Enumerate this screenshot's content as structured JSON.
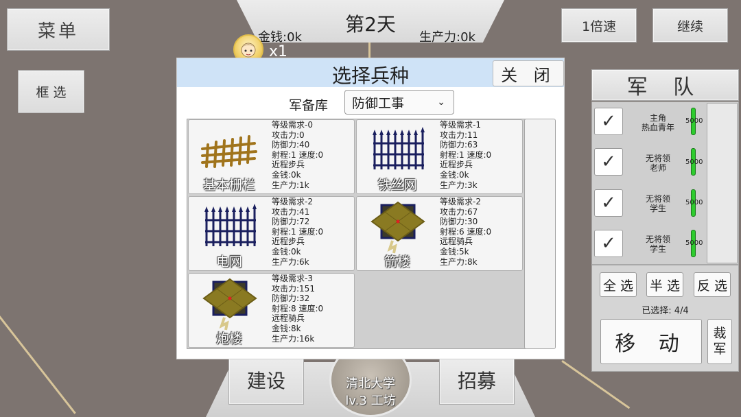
{
  "top": {
    "menu": "菜单",
    "box_select": "框 选",
    "day": "第2天",
    "money": "金钱:0k",
    "productivity": "生产力:0k",
    "speed": "1倍速",
    "continue": "继续",
    "hero_multiplier": "x1"
  },
  "modal": {
    "title": "选择兵种",
    "close": "关 闭",
    "armory_label": "军备库",
    "armory_selected": "防御工事",
    "cards": [
      {
        "name": "基本栅栏",
        "icon": "wooden-fence-icon",
        "stats": [
          "等级需求-0",
          "攻击力:0",
          "防御力:40",
          "射程:1 速度:0",
          "近程步兵",
          "金钱:0k",
          "生产力:1k"
        ]
      },
      {
        "name": "铁丝网",
        "icon": "wire-fence-icon",
        "stats": [
          "等级需求-1",
          "攻击力:11",
          "防御力:63",
          "射程:1 速度:0",
          "近程步兵",
          "金钱:0k",
          "生产力:3k"
        ]
      },
      {
        "name": "电网",
        "icon": "electric-fence-icon",
        "stats": [
          "等级需求-2",
          "攻击力:41",
          "防御力:72",
          "射程:1 速度:0",
          "近程步兵",
          "金钱:0k",
          "生产力:6k"
        ]
      },
      {
        "name": "箭楼",
        "icon": "arrow-tower-icon",
        "stats": [
          "等级需求-2",
          "攻击力:67",
          "防御力:30",
          "射程:6 速度:0",
          "远程骑兵",
          "金钱:5k",
          "生产力:8k"
        ]
      },
      {
        "name": "炮楼",
        "icon": "cannon-tower-icon",
        "stats": [
          "等级需求-3",
          "攻击力:151",
          "防御力:32",
          "射程:8 速度:0",
          "远程骑兵",
          "金钱:8k",
          "生产力:16k"
        ]
      }
    ]
  },
  "army": {
    "title": "军 队",
    "units": [
      {
        "line1": "主角",
        "line2": "热血青年",
        "hp": "5000"
      },
      {
        "line1": "无将领",
        "line2": "老师",
        "hp": "5000"
      },
      {
        "line1": "无将领",
        "line2": "学生",
        "hp": "5000"
      },
      {
        "line1": "无将领",
        "line2": "学生",
        "hp": "5000"
      }
    ],
    "select_all": "全 选",
    "select_half": "半 选",
    "select_invert": "反 选",
    "selected_text": "已选择:  4/4",
    "move": "移 动",
    "disband": "裁\n军"
  },
  "bottom": {
    "build": "建设",
    "recruit": "招募",
    "campus_name": "清北大学",
    "campus_level": "lv.3 工坊"
  },
  "colors": {
    "background": "#7d7470",
    "modal_header": "#cfe3f7",
    "hp_bar": "#2ecc2e",
    "fence_wood": "#a0741c",
    "fence_wire": "#1a1f5e"
  }
}
